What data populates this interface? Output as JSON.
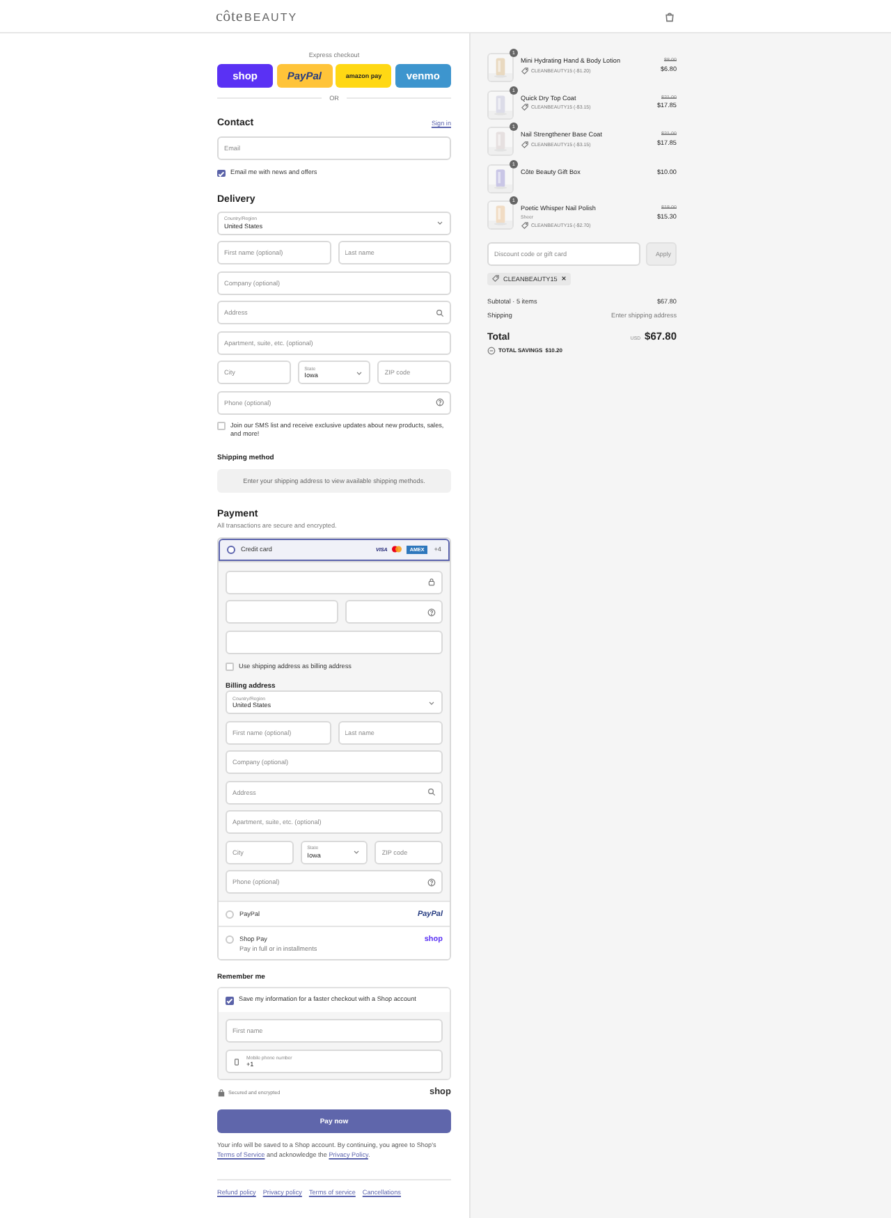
{
  "header": {
    "logo_script": "côte",
    "logo_caps": "BEAUTY"
  },
  "express": {
    "title": "Express checkout",
    "buttons": [
      {
        "kind": "shop",
        "label": "shop"
      },
      {
        "kind": "paypal",
        "label": "PayPal"
      },
      {
        "kind": "amazon",
        "label": "amazon pay"
      },
      {
        "kind": "venmo",
        "label": "venmo"
      }
    ],
    "divider": "OR"
  },
  "contact": {
    "title": "Contact",
    "link": "Sign in",
    "email": {
      "kind": "text",
      "placeholder": "Email"
    },
    "newsletter": {
      "label": "Email me with news and offers",
      "checked": true
    }
  },
  "delivery": {
    "title": "Delivery",
    "rows": [
      [
        {
          "kind": "select",
          "label": "Country/Region",
          "value": "United States"
        }
      ],
      [
        {
          "kind": "text",
          "placeholder": "First name (optional)"
        },
        {
          "kind": "text",
          "placeholder": "Last name"
        }
      ],
      [
        {
          "kind": "text",
          "placeholder": "Company (optional)"
        }
      ],
      [
        {
          "kind": "search",
          "placeholder": "Address"
        }
      ],
      [
        {
          "kind": "text",
          "placeholder": "Apartment, suite, etc. (optional)"
        }
      ],
      [
        {
          "kind": "text",
          "placeholder": "City"
        },
        {
          "kind": "select",
          "label": "State",
          "value": "Iowa"
        },
        {
          "kind": "text",
          "placeholder": "ZIP code"
        }
      ],
      [
        {
          "kind": "help",
          "placeholder": "Phone (optional)"
        }
      ]
    ],
    "sms": {
      "label": "Join our SMS list and receive exclusive updates about new products, sales, and more!",
      "checked": false
    }
  },
  "shipping_method": {
    "title": "Shipping method",
    "message": "Enter your shipping address to view available shipping methods."
  },
  "payment": {
    "title": "Payment",
    "subtitle": "All transactions are secure and encrypted.",
    "card": {
      "label": "Credit card",
      "selected": true,
      "brands": [
        {
          "kind": "visa",
          "label": "VISA"
        },
        {
          "kind": "mastercard"
        },
        {
          "kind": "amex",
          "label": "AMEX"
        }
      ],
      "more": "+4",
      "rows": [
        [
          {
            "kind": "lock"
          }
        ],
        [
          {
            "kind": "text"
          },
          {
            "kind": "help"
          }
        ],
        [
          {
            "kind": "text"
          }
        ]
      ],
      "use_shipping": {
        "label": "Use shipping address as billing address",
        "checked": false
      },
      "billing_title": "Billing address",
      "billing_rows": [
        [
          {
            "kind": "select",
            "label": "Country/Region",
            "value": "United States"
          }
        ],
        [
          {
            "kind": "text",
            "placeholder": "First name (optional)"
          },
          {
            "kind": "text",
            "placeholder": "Last name"
          }
        ],
        [
          {
            "kind": "text",
            "placeholder": "Company (optional)"
          }
        ],
        [
          {
            "kind": "search",
            "placeholder": "Address"
          }
        ],
        [
          {
            "kind": "text",
            "placeholder": "Apartment, suite, etc. (optional)"
          }
        ],
        [
          {
            "kind": "text",
            "placeholder": "City"
          },
          {
            "kind": "select",
            "label": "State",
            "value": "Iowa"
          },
          {
            "kind": "text",
            "placeholder": "ZIP code"
          }
        ],
        [
          {
            "kind": "help",
            "placeholder": "Phone (optional)"
          }
        ]
      ]
    },
    "others": [
      {
        "kind": "paypal",
        "label": "PayPal",
        "logo": "PayPal",
        "selected": false
      },
      {
        "kind": "shop",
        "label": "Shop Pay",
        "sublabel": "Pay in full or in installments",
        "logo": "shop",
        "selected": false
      }
    ]
  },
  "remember": {
    "title": "Remember me",
    "save": {
      "label": "Save my information for a faster checkout with a Shop account",
      "checked": true
    },
    "first_name": {
      "kind": "text",
      "placeholder": "First name"
    },
    "phone": {
      "kind": "phone",
      "label": "Mobile phone number",
      "value": "+1"
    },
    "secure": "Secured and encrypted",
    "logo": "shop"
  },
  "pay_button": "Pay now",
  "terms": [
    {
      "kind": "text",
      "text": "Your info will be saved to a Shop account. By continuing, you agree to Shop's "
    },
    {
      "kind": "link",
      "text": "Terms of Service"
    },
    {
      "kind": "text",
      "text": " and acknowledge the "
    },
    {
      "kind": "link",
      "text": "Privacy Policy"
    },
    {
      "kind": "text",
      "text": "."
    }
  ],
  "footer_links": [
    "Refund policy",
    "Privacy policy",
    "Terms of service",
    "Cancellations"
  ],
  "summary": {
    "items": [
      {
        "qty": "1",
        "name": "Mini Hydrating Hand & Body Lotion",
        "discount": "CLEANBEAUTY15 (-$1.20)",
        "original": "$8.00",
        "price": "$6.80"
      },
      {
        "qty": "1",
        "name": "Quick Dry Top Coat",
        "discount": "CLEANBEAUTY15 (-$3.15)",
        "original": "$21.00",
        "price": "$17.85"
      },
      {
        "qty": "1",
        "name": "Nail Strengthener Base Coat",
        "discount": "CLEANBEAUTY15 (-$3.15)",
        "original": "$21.00",
        "price": "$17.85"
      },
      {
        "qty": "1",
        "name": "Côte Beauty Gift Box",
        "price": "$10.00"
      },
      {
        "qty": "1",
        "name": "Poetic Whisper Nail Polish",
        "variant": "Sheer",
        "discount": "CLEANBEAUTY15 (-$2.70)",
        "original": "$18.00",
        "price": "$15.30"
      }
    ],
    "discount_placeholder": "Discount code or gift card",
    "apply": "Apply",
    "applied_code": "CLEANBEAUTY15",
    "subtotal_label": "Subtotal · 5 items",
    "subtotal": "$67.80",
    "shipping_label": "Shipping",
    "shipping": "Enter shipping address",
    "total_label": "Total",
    "currency": "USD",
    "total": "$67.80",
    "savings_label": "TOTAL SAVINGS",
    "savings": "$10.20"
  }
}
